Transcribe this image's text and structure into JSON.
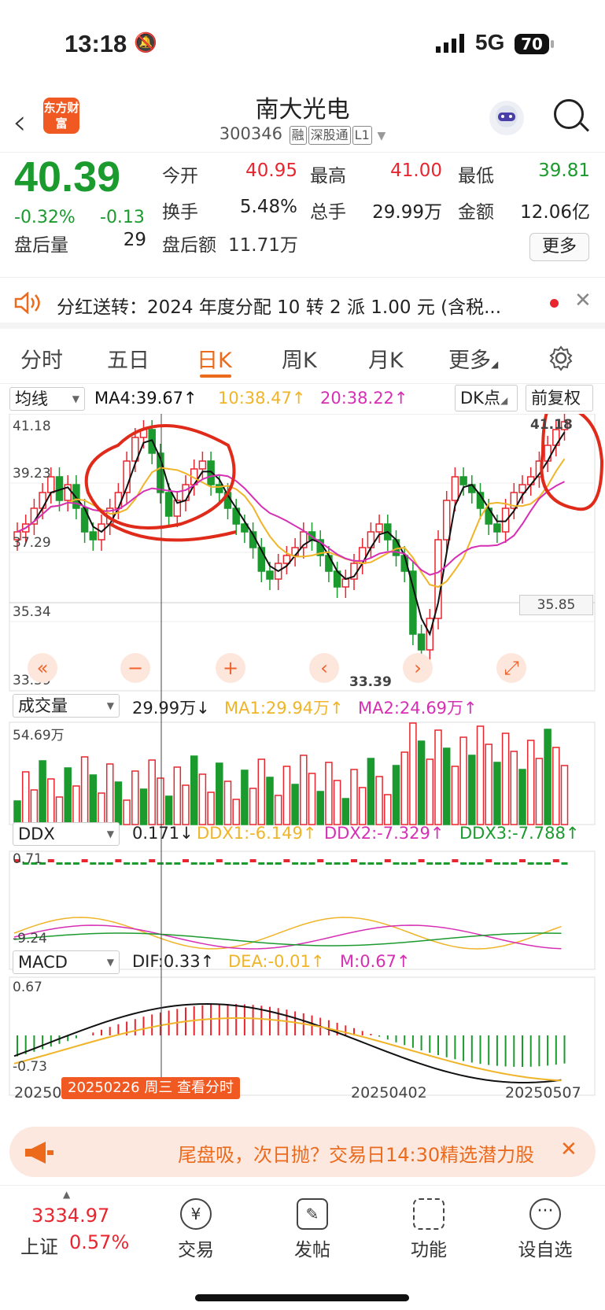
{
  "status": {
    "time": "13:18",
    "network": "5G",
    "battery": "70"
  },
  "header": {
    "logo": "东方财富",
    "stock_name": "南大光电",
    "stock_code": "300346",
    "tags": [
      "融",
      "深股通",
      "L1"
    ]
  },
  "quote": {
    "price": "40.39",
    "change_pct": "-0.32%",
    "change": "-0.13",
    "open_label": "今开",
    "open": "40.95",
    "high_label": "最高",
    "high": "41.00",
    "low_label": "最低",
    "low": "39.81",
    "turnover_label": "换手",
    "turnover": "5.48%",
    "volume_label": "总手",
    "volume": "29.99万",
    "amount_label": "金额",
    "amount": "12.06亿",
    "after_vol_label": "盘后量",
    "after_vol": "29",
    "after_amt_label": "盘后额",
    "after_amt": "11.71万",
    "more_label": "更多"
  },
  "notice": {
    "text": "分红送转：2024 年度分配 10 转 2 派 1.00 元 (含税..."
  },
  "tabs": [
    "分时",
    "五日",
    "日K",
    "周K",
    "月K",
    "更多"
  ],
  "active_tab": "日K",
  "kline": {
    "ma_select": "均线",
    "ma4": "MA4:39.67↑",
    "ma10": "10:38.47↑",
    "ma20": "20:38.22↑",
    "dk_label": "DK点",
    "fq_label": "前复权",
    "y_ticks": [
      "41.18",
      "39.23",
      "37.29",
      "35.34",
      "33.39"
    ],
    "max_label": "41.18",
    "min_label": "33.39",
    "cur_label": "35.85"
  },
  "volume": {
    "select": "成交量",
    "value": "29.99万↓",
    "ma1": "MA1:29.94万↑",
    "ma2": "MA2:24.69万↑",
    "top_label": "54.69万"
  },
  "ddx": {
    "select": "DDX",
    "value": "0.171↓",
    "ddx1": "DDX1:-6.149↑",
    "ddx2": "DDX2:-7.329↑",
    "ddx3": "DDX3:-7.788↑",
    "top": "0.71",
    "bottom": "-9.24"
  },
  "macd": {
    "select": "MACD",
    "dif": "DIF:0.33↑",
    "dea": "DEA:-0.01↑",
    "m": "M:0.67↑",
    "top": "0.67",
    "bottom": "-0.73"
  },
  "dates": {
    "left": "20250121",
    "mid": "20250402",
    "right": "20250507",
    "tooltip": "20250226 周三 查看分时"
  },
  "colors": {
    "up": "#e8262f",
    "down": "#1b9a2e",
    "accent": "#ec6a1c",
    "ma_yellow": "#f0b429",
    "ma_pink": "#d62fb4"
  },
  "banner": {
    "text": "尾盘吸，次日抛？交易日14:30精选潜力股"
  },
  "nav": {
    "index_value": "3334.97",
    "index_name": "上证",
    "index_pct": "0.57%",
    "items": [
      "交易",
      "发帖",
      "功能",
      "设自选"
    ]
  }
}
